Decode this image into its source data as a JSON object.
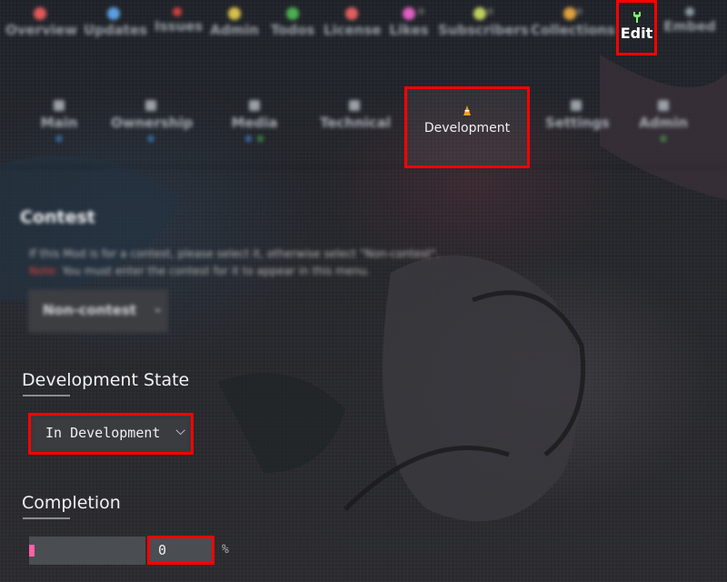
{
  "top_nav": {
    "items": [
      {
        "label": "Overview",
        "icon": "home-icon",
        "color": "#e05a5a"
      },
      {
        "label": "Updates",
        "icon": "globe-icon",
        "color": "#5aa0e0"
      },
      {
        "label": "Issues",
        "icon": "bug-icon",
        "color": "#d04040"
      },
      {
        "label": "Admin",
        "icon": "lightbulb-icon",
        "color": "#d8c04a"
      },
      {
        "label": "Todos",
        "icon": "checklist-icon",
        "color": "#4caf50"
      },
      {
        "label": "License",
        "icon": "copyright-icon",
        "color": "#e06060"
      },
      {
        "label": "Likes",
        "icon": "heart-icon",
        "color": "#e060c0",
        "count": "0"
      },
      {
        "label": "Subscribers",
        "icon": "bell-icon",
        "color": "#c0d060",
        "count": "0"
      },
      {
        "label": "Collections",
        "icon": "folder-icon",
        "color": "#e0a040",
        "count": "0"
      },
      {
        "label": "Edit",
        "icon": "wrench-icon",
        "color": "#7cff6a"
      },
      {
        "label": "Embed",
        "icon": "share-icon",
        "color": "#8a9aa0"
      }
    ]
  },
  "sub_tabs": {
    "items": [
      {
        "label": "Main",
        "icon": "home-icon",
        "badges": [
          "0"
        ],
        "badge_colors": [
          "blue"
        ]
      },
      {
        "label": "Ownership",
        "icon": "users-icon",
        "badges": [
          "0"
        ],
        "badge_colors": [
          "blue"
        ]
      },
      {
        "label": "Media",
        "icon": "image-icon",
        "badges": [
          "0",
          "0"
        ],
        "badge_colors": [
          "blue",
          "green"
        ]
      },
      {
        "label": "Technical",
        "icon": "gear-icon",
        "badges": [],
        "badge_colors": []
      },
      {
        "label": "Development",
        "icon": "traffic-cone-icon",
        "badges": [],
        "badge_colors": []
      },
      {
        "label": "Settings",
        "icon": "wrench-icon",
        "badges": [],
        "badge_colors": []
      },
      {
        "label": "Admin",
        "icon": "shield-icon",
        "badges": [
          "0"
        ],
        "badge_colors": [
          "green"
        ]
      }
    ]
  },
  "contest": {
    "title": "Contest",
    "hint": "If this Mod is for a contest, please select it, otherwise select \"Non-contest\".",
    "note_label": "Note:",
    "note_text": "You must enter the contest for it to appear in this menu.",
    "selected": "Non-contest"
  },
  "development_state": {
    "title": "Development State",
    "selected": "In Development"
  },
  "completion": {
    "title": "Completion",
    "value": "0",
    "unit": "%",
    "progress_fraction": 0.05
  },
  "colors": {
    "highlight_border": "#ff0000",
    "progress_fill": "#ff5fa6",
    "edit_icon": "#7cff6a"
  }
}
